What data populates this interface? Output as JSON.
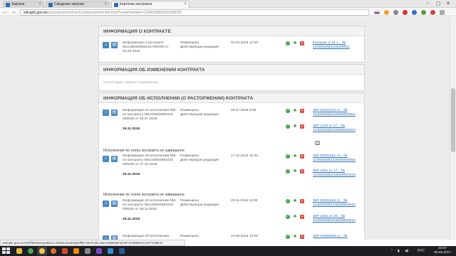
{
  "tabs": [
    {
      "title": "Закупки",
      "active": false
    },
    {
      "title": "Сведения закупки",
      "active": false
    },
    {
      "title": "Карточка контракта",
      "active": true
    }
  ],
  "address": {
    "host": "zakupki.gov.ru",
    "path": "/epz/contract/contractCard/document-info.html?reestrNumber=1246002883416000030"
  },
  "sections": {
    "contract": {
      "title": "ИНФОРМАЦИЯ О КОНТРАКТЕ",
      "row": {
        "name": "Информация о контракте №1246002883416 000030 от 02.03.2016",
        "status": "Размещено Действующая редакция",
        "date": "02.03.2016 12:20",
        "link": "Контракт 2-15 1... № 1246002883416000002"
      }
    },
    "changes": {
      "title": "ИНФОРМАЦИЯ ОБ ИЗМЕНЕНИИ КОНТРАКТА",
      "empty_text": "Отсутствуют записи о документах"
    },
    "execution": {
      "title": "ИНФОРМАЦИЯ ОБ ИСПОЛНЕНИИ (О РАСТОРЖЕНИИ) КОНТРАКТА",
      "rows": [
        {
          "name": "Информация об исполнении №5 по контракту №1246002883416 000030 от 28.07.2016",
          "date_bold": "25.11.2016",
          "status": "Размещено Действующая редакция",
          "date": "28.07.2016 9:59",
          "links": [
            "ЗКР 00001370 от... № 1246002883416000000004",
            "ЗКР 1370 от 27... № 1246002883416000000003"
          ]
        },
        {
          "stage": "Исполнение по этапу контракта не завершено",
          "name": "Информация об исполнении №5 по контракту №1246002883416 000030 от 17.10.2016",
          "date_bold": "25.11.2016",
          "status": "Размещено Действующая редакция",
          "date": "17.10.2016 10:32",
          "links": [
            "ЗКР 00001931 от... № 1246002883416000000005",
            "ЗКР 1931 от 17... № 1246002883416000000016"
          ]
        },
        {
          "stage": "Исполнение по этапу контракта не завершено",
          "name": "Информация об исполнении №6 по контракту №1246002883416 000030 от 29.11.2016",
          "date_bold": "25.11.2016",
          "status": "Размещено Действующая редакция",
          "date": "29.11.2016 11:00",
          "links": [
            "ЗКР 00002264 от... № 1246002883416000000018",
            "ЗКР 2264 от 29... № 1246002883416000000019"
          ]
        },
        {
          "name": "Информация об исполнении",
          "status": "Размещено",
          "date": "10.09.2016 10:06",
          "links": [
            "ЗКР 00005008 от... №"
          ]
        }
      ]
    }
  },
  "status_url": "zakupki.gov.ru/44fz/filestore/public/1.0/download/rgk2/file.html?uid=28ACD952BA5C0F1C809DAC1107148E17",
  "clock": {
    "time": "23:07",
    "date": "30.08.2017"
  },
  "tray_lang": "РУС"
}
